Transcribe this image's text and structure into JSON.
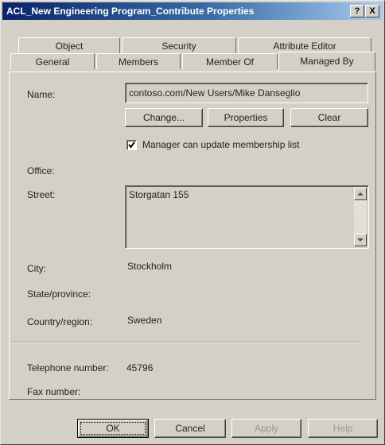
{
  "window": {
    "title": "ACL_New Engineering Program_Contribute Properties",
    "help_button": "?",
    "close_button": "X"
  },
  "tabs": {
    "row1": [
      "Object",
      "Security",
      "Attribute Editor"
    ],
    "row2": [
      "General",
      "Members",
      "Member Of",
      "Managed By"
    ],
    "active": "Managed By"
  },
  "managed_by": {
    "name_label": "Name:",
    "name_value": "contoso.com/New Users/Mike Danseglio",
    "change_button": "Change...",
    "properties_button": "Properties",
    "clear_button": "Clear",
    "manager_update_checked": true,
    "manager_update_label": "Manager can update membership list",
    "office_label": "Office:",
    "office_value": "",
    "street_label": "Street:",
    "street_value": "Storgatan 155",
    "city_label": "City:",
    "city_value": "Stockholm",
    "state_label": "State/province:",
    "state_value": "",
    "country_label": "Country/region:",
    "country_value": "Sweden",
    "telephone_label": "Telephone number:",
    "telephone_value": "45796",
    "fax_label": "Fax number:",
    "fax_value": ""
  },
  "footer": {
    "ok": "OK",
    "cancel": "Cancel",
    "apply": "Apply",
    "help": "Help"
  }
}
